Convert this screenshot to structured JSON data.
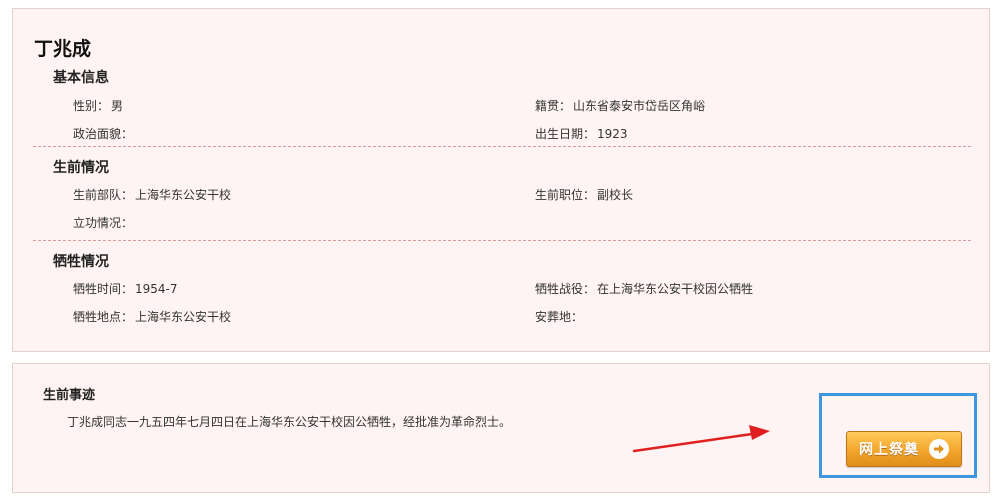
{
  "person": {
    "name": "丁兆成"
  },
  "basic_info": {
    "title": "基本信息",
    "gender_label": "性别：",
    "gender": "男",
    "native_label": "籍贯：",
    "native": "山东省泰安市岱岳区角峪",
    "political_label": "政治面貌：",
    "political": "",
    "birth_label": "出生日期：",
    "birth": "1923"
  },
  "life": {
    "title": "生前情况",
    "unit_label": "生前部队：",
    "unit": "上海华东公安干校",
    "position_label": "生前职位：",
    "position": "副校长",
    "merit_label": "立功情况：",
    "merit": ""
  },
  "sacrifice": {
    "title": "牺牲情况",
    "time_label": "牺牲时间：",
    "time": "1954-7",
    "battle_label": "牺牲战役：",
    "battle": "在上海华东公安干校因公牺牲",
    "place_label": "牺牲地点：",
    "place": "上海华东公安干校",
    "burial_label": "安葬地：",
    "burial": ""
  },
  "story": {
    "title": "生前事迹",
    "text": "丁兆成同志一九五四年七月四日在上海华东公安干校因公牺牲，经批准为革命烈士。"
  },
  "actions": {
    "tribute_label": "网上祭奠",
    "tribute_icon": "arrow-right-circle-icon"
  },
  "colors": {
    "panel_bg": "#fff4f3",
    "divider": "#d99a9a",
    "button": "#f3a52c",
    "highlight": "#3e96e0",
    "annotation_arrow": "#e02020"
  }
}
